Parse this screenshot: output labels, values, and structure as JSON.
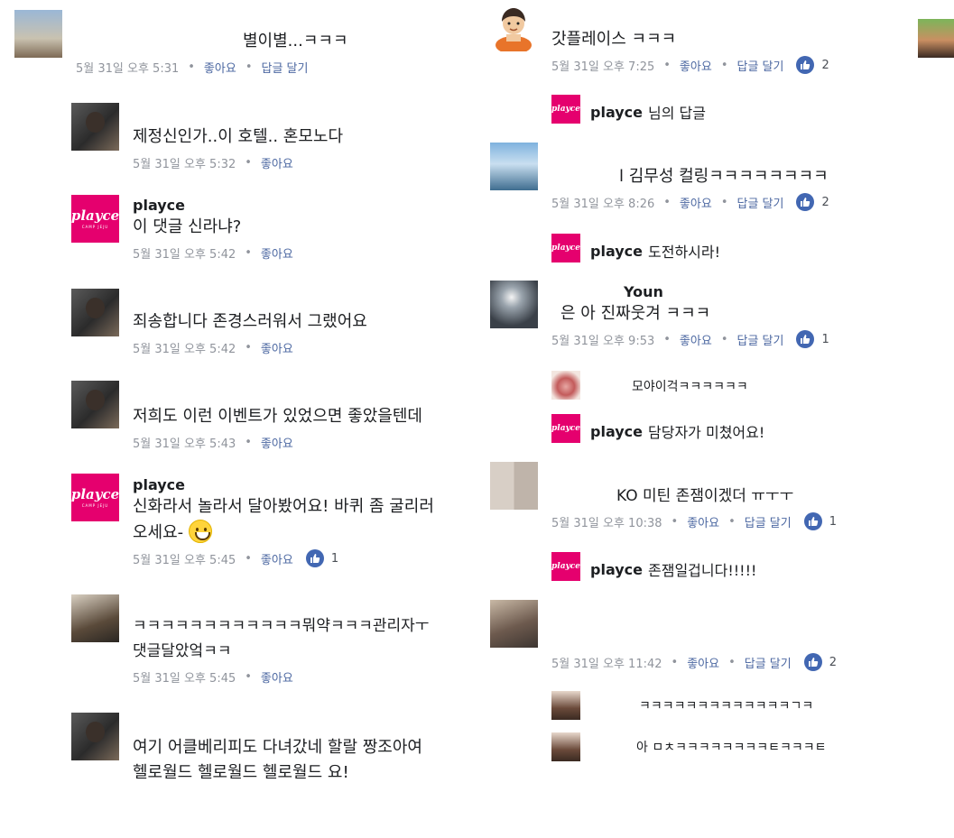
{
  "like_icon": "thumbs-up-icon",
  "colors": {
    "link": "#4b67a1",
    "meta": "#90949c",
    "brand": "#e5006e",
    "like": "#4267b2"
  },
  "left": [
    {
      "body": "별이별...ㅋㅋㅋ",
      "time": "5월 31일 오후 5:31",
      "like": "좋아요",
      "reply": "답글 달기"
    },
    {
      "body": "제정신인가..이 호텔.. 혼모노다",
      "time": "5월 31일 오후 5:32",
      "like": "좋아요"
    },
    {
      "author": "playce",
      "body": "이 댓글 신라냐?",
      "time": "5월 31일 오후 5:42",
      "like": "좋아요",
      "avatar_text": "playce",
      "avatar_sub": "CAMP JEJU"
    },
    {
      "body": "죄송합니다 존경스러워서 그랬어요",
      "time": "5월 31일 오후 5:42",
      "like": "좋아요"
    },
    {
      "body": "저희도 이런 이벤트가 있었으면 좋았을텐데",
      "time": "5월 31일 오후 5:43",
      "like": "좋아요"
    },
    {
      "author": "playce",
      "body": "신화라서 놀라서 달아봤어요! 바퀴 좀 굴리러",
      "body2": "오세요-",
      "time": "5월 31일 오후 5:45",
      "like": "좋아요",
      "likes_count": "1",
      "avatar_text": "playce",
      "avatar_sub": "CAMP JEJU"
    },
    {
      "body": "ㅋㅋㅋㅋㅋㅋㅋㅋㅋㅋㅋㅋ뭐약ㅋㅋㅋ관리자ㅜ",
      "body2": "댓글달았엌ㅋㅋ",
      "time": "5월 31일 오후 5:45",
      "like": "좋아요"
    },
    {
      "body": "여기 어클베리피도 다녀갔네 할랄 짱조아여",
      "body2": "헬로월드 헬로월드 헬로월드 요!"
    }
  ],
  "right": [
    {
      "body": "갓플레이스 ㅋㅋㅋ",
      "time": "5월 31일 오후 7:25",
      "like": "좋아요",
      "reply": "답글 달기",
      "likes_count": "2"
    },
    {
      "author": "playce",
      "body": "님의 답글",
      "avatar_text": "playce"
    },
    {
      "body": "l 김무성 컬링ㅋㅋㅋㅋㅋㅋㅋㅋ",
      "time": "5월 31일 오후 8:26",
      "like": "좋아요",
      "reply": "답글 달기",
      "likes_count": "2"
    },
    {
      "author": "playce",
      "body": "도전하시라!",
      "avatar_text": "playce"
    },
    {
      "author": "Youn",
      "body": "은 아 진짜웃겨 ㅋㅋㅋ",
      "time": "5월 31일 오후 9:53",
      "like": "좋아요",
      "reply": "답글 달기",
      "likes_count": "1"
    },
    {
      "body": "모야이걱ㅋㅋㅋㅋㅋㅋ"
    },
    {
      "author": "playce",
      "body": "담당자가 미쳤어요!",
      "avatar_text": "playce"
    },
    {
      "body": "KO 미틴 존잼이겠더 ㅠㅜㅜ",
      "time": "5월 31일 오후 10:38",
      "like": "좋아요",
      "reply": "답글 달기",
      "likes_count": "1"
    },
    {
      "author": "playce",
      "body": "존잼일겁니다!!!!!",
      "avatar_text": "playce"
    },
    {
      "time": "5월 31일 오후 11:42",
      "like": "좋아요",
      "reply": "답글 달기",
      "likes_count": "2"
    },
    {
      "body": "ㅋㅋㅋㅋㅋㅋㅋㅋㅋㅋㅋㅋㅋㄱㅋ"
    },
    {
      "body": "아 ㅁㅊㅋㅋㅋㅋㅋㅋㅋㅋㅌㅋㅋㅋㅌ"
    }
  ]
}
